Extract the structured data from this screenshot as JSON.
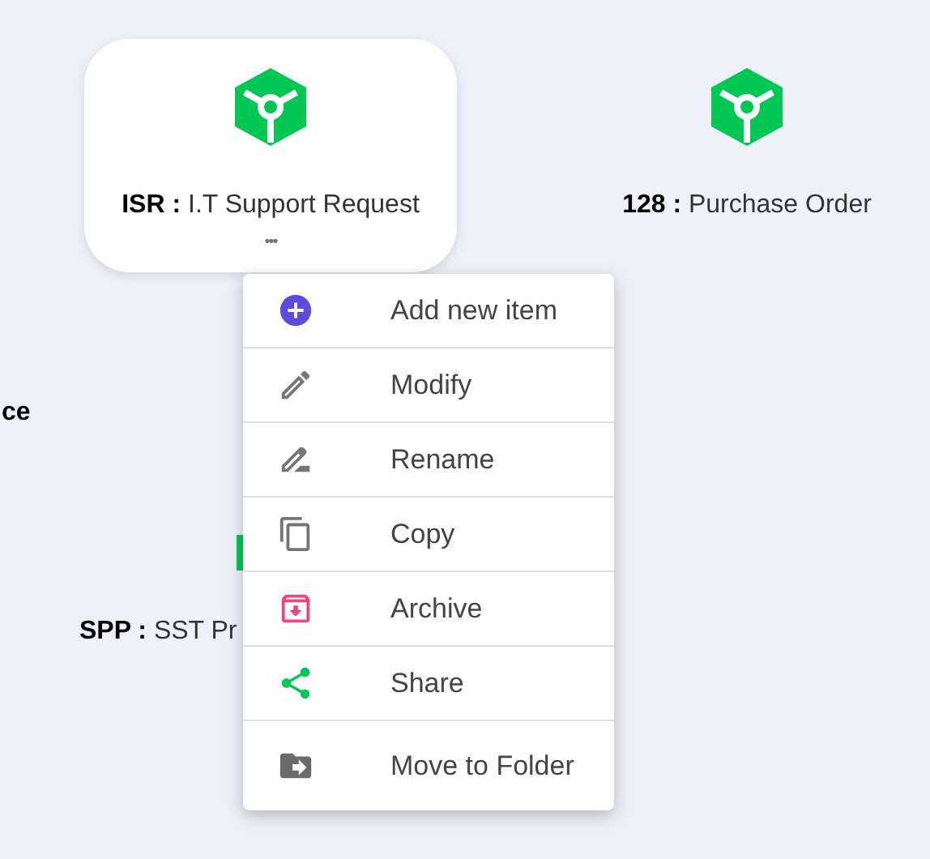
{
  "tiles": [
    {
      "code": "ISR :",
      "name": "I.T Support Request",
      "highlighted": true,
      "kind": "full"
    },
    {
      "code": "128 :",
      "name": "Purchase Order",
      "highlighted": false,
      "kind": "full"
    },
    {
      "code": "ce",
      "kind": "fragment"
    },
    {
      "code": "SPP :",
      "name": "SST Pr",
      "kind": "covered"
    }
  ],
  "menu_button": "•••",
  "context_menu": {
    "items": [
      {
        "label": "Add new item",
        "color": "#5b4ce0"
      },
      {
        "label": "Modify",
        "color": "#757575"
      },
      {
        "label": "Rename",
        "color": "#757575"
      },
      {
        "label": "Copy",
        "color": "#757575"
      },
      {
        "label": "Archive",
        "color": "#f0457a"
      },
      {
        "label": "Share",
        "color": "#00c853"
      },
      {
        "label": "Move to Folder",
        "color": "#6b6b6b"
      }
    ]
  }
}
